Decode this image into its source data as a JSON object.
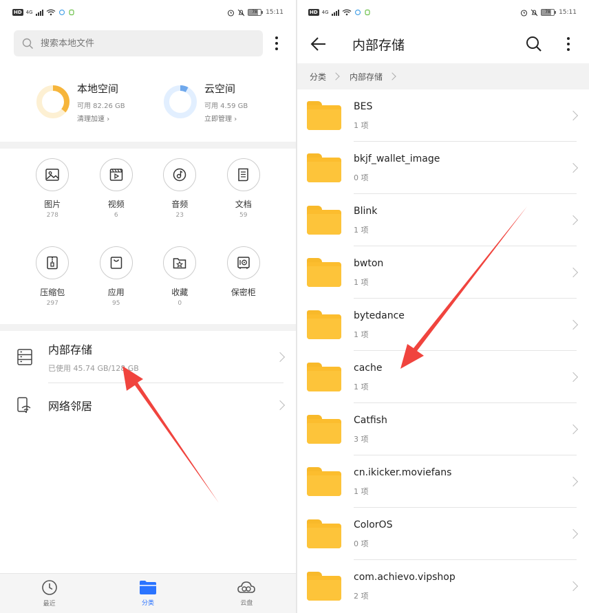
{
  "left": {
    "status": {
      "network": "4G",
      "time": "15:11",
      "battery": "78"
    },
    "search": {
      "placeholder": "搜索本地文件"
    },
    "spaces": [
      {
        "title": "本地空间",
        "avail": "可用 82.26 GB",
        "action": "清理加速",
        "color": "#f6b53b",
        "used_fraction": 0.36
      },
      {
        "title": "云空间",
        "avail": "可用 4.59 GB",
        "action": "立即管理",
        "color": "#6fa8ec",
        "used_fraction": 0.08
      }
    ],
    "categories": [
      {
        "icon": "image-icon",
        "label": "图片",
        "count": "278"
      },
      {
        "icon": "video-icon",
        "label": "视频",
        "count": "6"
      },
      {
        "icon": "music-icon",
        "label": "音频",
        "count": "23"
      },
      {
        "icon": "document-icon",
        "label": "文档",
        "count": "59"
      },
      {
        "icon": "zip-icon",
        "label": "压缩包",
        "count": "297"
      },
      {
        "icon": "app-bag-icon",
        "label": "应用",
        "count": "95"
      },
      {
        "icon": "star-folder-icon",
        "label": "收藏",
        "count": "0"
      },
      {
        "icon": "safe-icon",
        "label": "保密柜",
        "count": ""
      }
    ],
    "locations": [
      {
        "title": "内部存储",
        "sub": "已使用 45.74 GB/128 GB"
      },
      {
        "title": "网络邻居",
        "sub": ""
      }
    ],
    "nav": [
      {
        "label": "最近",
        "icon": "clock-icon",
        "active": false
      },
      {
        "label": "分类",
        "icon": "folder-icon",
        "active": true
      },
      {
        "label": "云盘",
        "icon": "cloud-icon",
        "active": false
      }
    ]
  },
  "right": {
    "status": {
      "network": "4G",
      "time": "15:11",
      "battery": "78"
    },
    "title": "内部存储",
    "breadcrumb": [
      "分类",
      "内部存储"
    ],
    "folders": [
      {
        "name": "BES",
        "count": "1 项"
      },
      {
        "name": "bkjf_wallet_image",
        "count": "0 项"
      },
      {
        "name": "Blink",
        "count": "1 项"
      },
      {
        "name": "bwton",
        "count": "1 项"
      },
      {
        "name": "bytedance",
        "count": "1 项"
      },
      {
        "name": "cache",
        "count": "1 项"
      },
      {
        "name": "Catfish",
        "count": "3 项"
      },
      {
        "name": "cn.ikicker.moviefans",
        "count": "1 项"
      },
      {
        "name": "ColorOS",
        "count": "0 项"
      },
      {
        "name": "com.achievo.vipshop",
        "count": "2 项"
      }
    ]
  },
  "annotation": {
    "arrow_color": "#f0443e"
  }
}
